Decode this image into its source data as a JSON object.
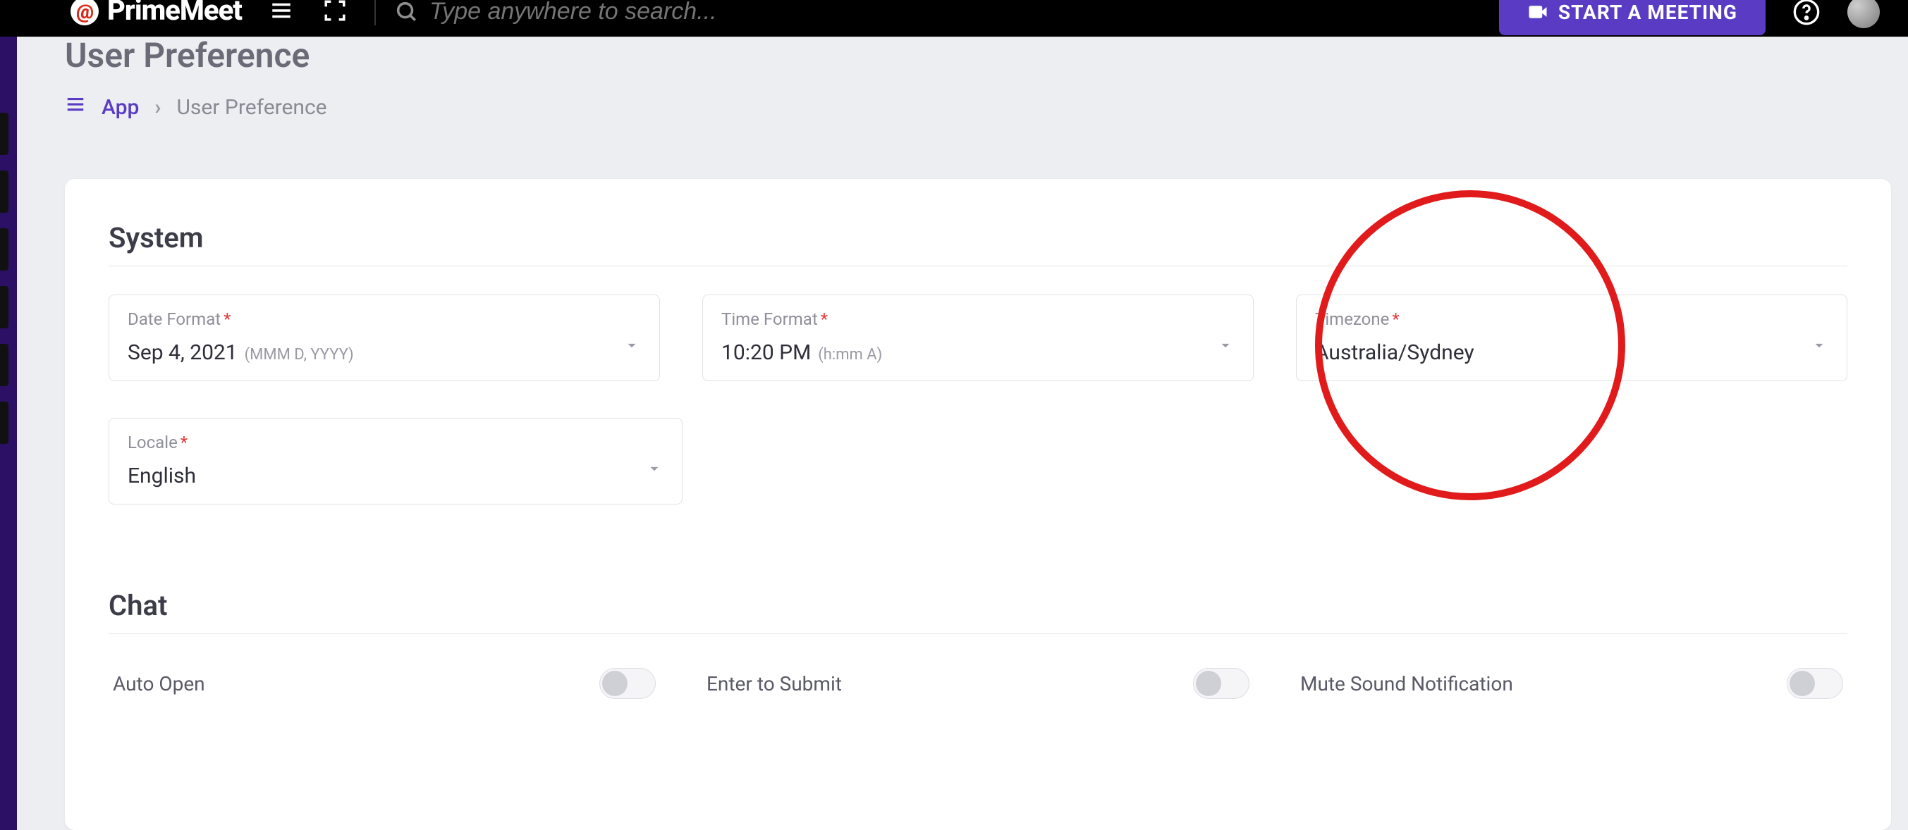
{
  "topbar": {
    "brand": "PrimeMeet",
    "search_placeholder": "Type anywhere to search...",
    "start_meeting_label": "START A MEETING"
  },
  "page": {
    "title": "User Preference",
    "breadcrumb": {
      "root": "App",
      "current": "User Preference"
    }
  },
  "sections": {
    "system_title": "System",
    "chat_title": "Chat"
  },
  "fields": {
    "date_format": {
      "label": "Date Format",
      "value": "Sep 4, 2021",
      "hint": "(MMM D, YYYY)"
    },
    "time_format": {
      "label": "Time Format",
      "value": "10:20 PM",
      "hint": "(h:mm A)"
    },
    "timezone": {
      "label": "Timezone",
      "value": "Australia/Sydney"
    },
    "locale": {
      "label": "Locale",
      "value": "English"
    }
  },
  "chat": {
    "auto_open": {
      "label": "Auto Open",
      "on": false
    },
    "enter_submit": {
      "label": "Enter to Submit",
      "on": false
    },
    "mute_sound": {
      "label": "Mute Sound Notification",
      "on": false
    }
  }
}
